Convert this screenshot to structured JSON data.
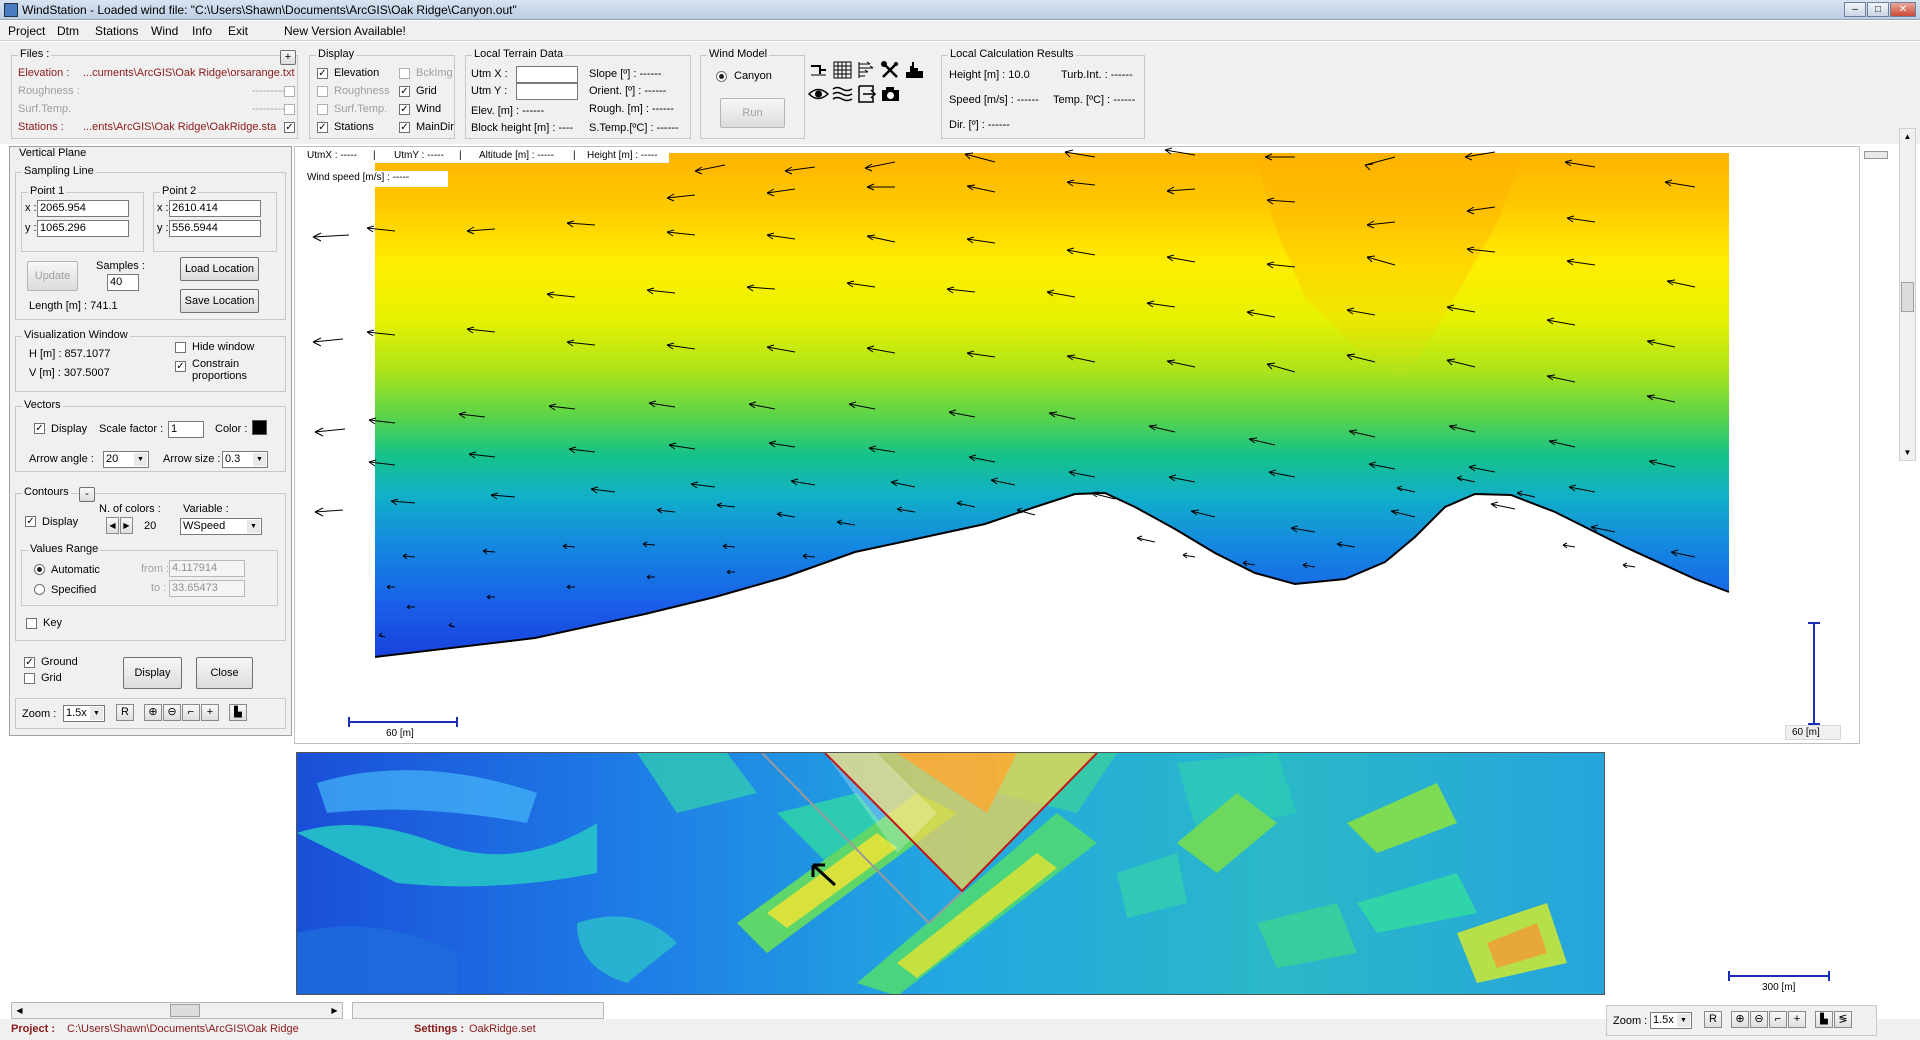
{
  "window": {
    "title": "WindStation - Loaded wind file:  \"C:\\Users\\Shawn\\Documents\\ArcGIS\\Oak Ridge\\Canyon.out\""
  },
  "menu": {
    "items": [
      "Project",
      "Dtm",
      "Stations",
      "Wind",
      "Info",
      "Exit"
    ],
    "notice": "New Version Available!"
  },
  "files": {
    "title": "Files :",
    "add_label": "+",
    "rows": [
      {
        "label": "Elevation :",
        "value": "...cuments\\ArcGIS\\Oak Ridge\\orsarange.txt",
        "checked": false,
        "active": true
      },
      {
        "label": "Roughness :",
        "value": "---------",
        "checked": false,
        "active": false
      },
      {
        "label": "Surf.Temp.",
        "value": "---------",
        "checked": false,
        "active": false
      },
      {
        "label": "Stations :",
        "value": "...ents\\ArcGIS\\Oak Ridge\\OakRidge.sta",
        "checked": true,
        "active": true
      }
    ]
  },
  "display_group": {
    "title": "Display",
    "items": [
      {
        "label": "Elevation",
        "checked": true,
        "enabled": true
      },
      {
        "label": "Roughness",
        "checked": false,
        "enabled": false
      },
      {
        "label": "Surf.Temp.",
        "checked": false,
        "enabled": false
      },
      {
        "label": "Stations",
        "checked": true,
        "enabled": true
      },
      {
        "label": "BckImg",
        "checked": false,
        "enabled": false
      },
      {
        "label": "Grid",
        "checked": true,
        "enabled": true
      },
      {
        "label": "Wind",
        "checked": true,
        "enabled": true
      },
      {
        "label": "MainDir",
        "checked": true,
        "enabled": true
      }
    ]
  },
  "terrain": {
    "title": "Local Terrain Data",
    "utmx_label": "Utm X :",
    "utmy_label": "Utm Y :",
    "utmx_value": "",
    "utmy_value": "",
    "elev": "Elev. [m] : ------",
    "block": "Block height [m] : ----",
    "slope": "Slope [º] : ------",
    "orient": "Orient. [º] : ------",
    "rough": "Rough. [m] : ------",
    "stemp": "S.Temp.[ºC] : ------"
  },
  "wind_model": {
    "title": "Wind Model",
    "option": "Canyon",
    "run_label": "Run"
  },
  "toolbar": {
    "icons": [
      "terrain-profile-icon",
      "grid-icon",
      "wind-profile-icon",
      "tools-icon",
      "stations-chart-icon",
      "eye-icon",
      "waves-icon",
      "export-icon",
      "camera-icon"
    ]
  },
  "results": {
    "title": "Local Calculation Results",
    "height": "Height [m] : 10.0",
    "turb": "Turb.Int. : ------",
    "speed": "Speed [m/s] : ------",
    "temp": "Temp. [ºC] : ------",
    "dir": "Dir. [º] : ------"
  },
  "vertical_plane": {
    "title": "Vertical Plane",
    "sampling_title": "Sampling Line",
    "p1_title": "Point 1",
    "p1_x": "2065.954",
    "p1_y": "1065.296",
    "p2_title": "Point 2",
    "p2_x": "2610.414",
    "p2_y": "556.5944",
    "x_label": "x :",
    "y_label": "y :",
    "update_label": "Update",
    "samples_label": "Samples :",
    "samples_value": "40",
    "load_label": "Load Location",
    "save_label": "Save Location",
    "length": "Length [m] : 741.1",
    "vis_title": "Visualization Window",
    "h": "H [m] : 857.1077",
    "v": "V [m] : 307.5007",
    "hide_label": "Hide window",
    "constrain_label1": "Constrain",
    "constrain_label2": "proportions",
    "vectors_title": "Vectors",
    "vec_display": "Display",
    "scale_label": "Scale factor :",
    "scale_value": "1",
    "color_label": "Color :",
    "arrow_angle_label": "Arrow angle :",
    "arrow_angle_value": "20",
    "arrow_size_label": "Arrow size :",
    "arrow_size_value": "0.3",
    "contours_title": "Contours",
    "contours_btn": "-",
    "cont_display": "Display",
    "ncolors_label": "N. of colors :",
    "ncolors_value": "20",
    "variable_label": "Variable :",
    "variable_value": "WSpeed",
    "values_range_title": "Values Range",
    "auto_label": "Automatic",
    "spec_label": "Specified",
    "from_label": "from :",
    "from_value": "4.117914",
    "to_label": "to :",
    "to_value": "33.65473",
    "key_label": "Key",
    "ground_label": "Ground",
    "grid_label": "Grid",
    "display_btn": "Display",
    "close_btn": "Close",
    "zoom_label": "Zoom :",
    "zoom_value": "1.5x",
    "r_label": "R"
  },
  "plot": {
    "utmx": "UtmX : -----",
    "utmy": "UtmY : -----",
    "alt": "Altitude [m] : -----",
    "height": "Height [m] : -----",
    "wspeed": "Wind speed [m/s] : -----",
    "hscale": "60  [m]",
    "vscale": "60  [m]"
  },
  "map": {
    "scale": "300  [m]"
  },
  "status": {
    "project_label": "Project :",
    "project_value": "C:\\Users\\Shawn\\Documents\\ArcGIS\\Oak Ridge",
    "settings_label": "Settings :",
    "settings_value": "OakRidge.set",
    "zoom_label": "Zoom :",
    "zoom_value": "1.5x",
    "r_label": "R"
  },
  "colors": {
    "accent_red": "#8b1a1a",
    "window_bg": "#f0f0f0"
  }
}
